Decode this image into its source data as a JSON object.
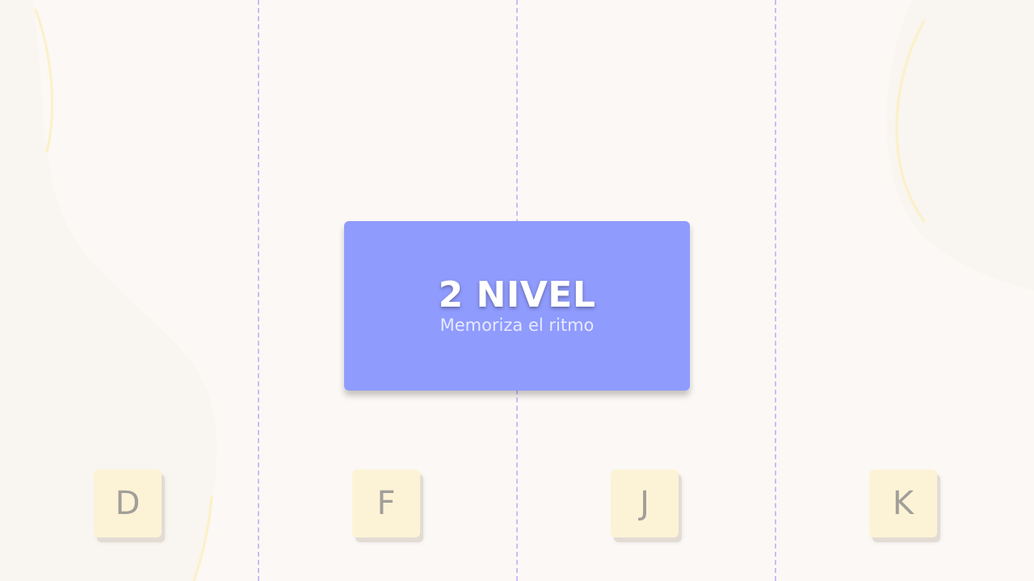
{
  "level": {
    "title": "2 NIVEL",
    "subtitle": "Memoriza el ritmo"
  },
  "keys": [
    {
      "label": "D"
    },
    {
      "label": "F"
    },
    {
      "label": "J"
    },
    {
      "label": "K"
    }
  ],
  "colors": {
    "background": "#fbf8f5",
    "lane_divider": "#cdbcf5",
    "key_fill": "#fcf3d6",
    "key_text": "#a29e99",
    "card_fill": "#8f9bfd",
    "decor_curve": "#fbefc4"
  }
}
